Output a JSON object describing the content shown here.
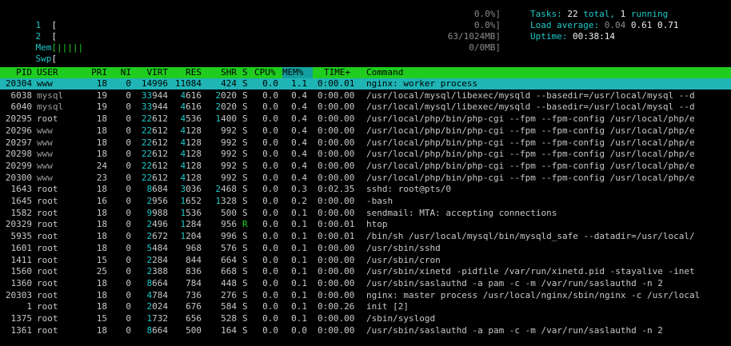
{
  "meters": {
    "cpu1": {
      "label": "1",
      "bar": "[",
      "value": "0.0%]"
    },
    "cpu2": {
      "label": "2",
      "bar": "[",
      "value": "0.0%]"
    },
    "mem": {
      "label": "Mem",
      "bar": "[|||||",
      "value": "63/1024MB]"
    },
    "swp": {
      "label": "Swp",
      "bar": "[",
      "value": "0/0MB]"
    }
  },
  "summary": {
    "tasks_label": "Tasks:",
    "tasks_total": "22",
    "total_label": "total,",
    "running": "1",
    "running_label": "running",
    "load_label": "Load average:",
    "load1": "0.04",
    "load5": "0.61",
    "load15": "0.71",
    "uptime_label": "Uptime:",
    "uptime": "00:38:14"
  },
  "columns": [
    "PID",
    "USER",
    "PRI",
    "NI",
    "VIRT",
    "RES",
    "SHR",
    "S",
    "CPU%",
    "MEM%",
    "TIME+",
    "Command"
  ],
  "processes": [
    {
      "pid": "20304",
      "user": "www",
      "pri": "18",
      "ni": "0",
      "virt": "14996",
      "res": "11084",
      "shr": "424",
      "s": "S",
      "cpu": "0.0",
      "mem": "1.1",
      "time": "0:00.01",
      "cmd": "nginx: worker process"
    },
    {
      "pid": "6038",
      "user": "mysql",
      "pri": "19",
      "ni": "0",
      "virt": "33944",
      "res": "4616",
      "shr": "2020",
      "s": "S",
      "cpu": "0.0",
      "mem": "0.4",
      "time": "0:00.00",
      "cmd": "/usr/local/mysql/libexec/mysqld --basedir=/usr/local/mysql --d"
    },
    {
      "pid": "6040",
      "user": "mysql",
      "pri": "19",
      "ni": "0",
      "virt": "33944",
      "res": "4616",
      "shr": "2020",
      "s": "S",
      "cpu": "0.0",
      "mem": "0.4",
      "time": "0:00.00",
      "cmd": "/usr/local/mysql/libexec/mysqld --basedir=/usr/local/mysql --d"
    },
    {
      "pid": "20295",
      "user": "root",
      "pri": "18",
      "ni": "0",
      "virt": "22612",
      "res": "4536",
      "shr": "1400",
      "s": "S",
      "cpu": "0.0",
      "mem": "0.4",
      "time": "0:00.00",
      "cmd": "/usr/local/php/bin/php-cgi --fpm --fpm-config /usr/local/php/e"
    },
    {
      "pid": "20296",
      "user": "www",
      "pri": "18",
      "ni": "0",
      "virt": "22612",
      "res": "4128",
      "shr": "992",
      "s": "S",
      "cpu": "0.0",
      "mem": "0.4",
      "time": "0:00.00",
      "cmd": "/usr/local/php/bin/php-cgi --fpm --fpm-config /usr/local/php/e"
    },
    {
      "pid": "20297",
      "user": "www",
      "pri": "18",
      "ni": "0",
      "virt": "22612",
      "res": "4128",
      "shr": "992",
      "s": "S",
      "cpu": "0.0",
      "mem": "0.4",
      "time": "0:00.00",
      "cmd": "/usr/local/php/bin/php-cgi --fpm --fpm-config /usr/local/php/e"
    },
    {
      "pid": "20298",
      "user": "www",
      "pri": "18",
      "ni": "0",
      "virt": "22612",
      "res": "4128",
      "shr": "992",
      "s": "S",
      "cpu": "0.0",
      "mem": "0.4",
      "time": "0:00.00",
      "cmd": "/usr/local/php/bin/php-cgi --fpm --fpm-config /usr/local/php/e"
    },
    {
      "pid": "20299",
      "user": "www",
      "pri": "24",
      "ni": "0",
      "virt": "22612",
      "res": "4128",
      "shr": "992",
      "s": "S",
      "cpu": "0.0",
      "mem": "0.4",
      "time": "0:00.00",
      "cmd": "/usr/local/php/bin/php-cgi --fpm --fpm-config /usr/local/php/e"
    },
    {
      "pid": "20300",
      "user": "www",
      "pri": "23",
      "ni": "0",
      "virt": "22612",
      "res": "4128",
      "shr": "992",
      "s": "S",
      "cpu": "0.0",
      "mem": "0.4",
      "time": "0:00.00",
      "cmd": "/usr/local/php/bin/php-cgi --fpm --fpm-config /usr/local/php/e"
    },
    {
      "pid": "1643",
      "user": "root",
      "pri": "18",
      "ni": "0",
      "virt": "8684",
      "res": "3036",
      "shr": "2468",
      "s": "S",
      "cpu": "0.0",
      "mem": "0.3",
      "time": "0:02.35",
      "cmd": "sshd: root@pts/0"
    },
    {
      "pid": "1645",
      "user": "root",
      "pri": "16",
      "ni": "0",
      "virt": "2956",
      "res": "1652",
      "shr": "1328",
      "s": "S",
      "cpu": "0.0",
      "mem": "0.2",
      "time": "0:00.00",
      "cmd": "-bash"
    },
    {
      "pid": "1582",
      "user": "root",
      "pri": "18",
      "ni": "0",
      "virt": "9988",
      "res": "1536",
      "shr": "500",
      "s": "S",
      "cpu": "0.0",
      "mem": "0.1",
      "time": "0:00.00",
      "cmd": "sendmail: MTA: accepting connections"
    },
    {
      "pid": "20329",
      "user": "root",
      "pri": "18",
      "ni": "0",
      "virt": "2496",
      "res": "1284",
      "shr": "956",
      "s": "R",
      "cpu": "0.0",
      "mem": "0.1",
      "time": "0:00.01",
      "cmd": "htop"
    },
    {
      "pid": "5935",
      "user": "root",
      "pri": "18",
      "ni": "0",
      "virt": "2672",
      "res": "1204",
      "shr": "996",
      "s": "S",
      "cpu": "0.0",
      "mem": "0.1",
      "time": "0:00.01",
      "cmd": "/bin/sh /usr/local/mysql/bin/mysqld_safe --datadir=/usr/local/"
    },
    {
      "pid": "1601",
      "user": "root",
      "pri": "18",
      "ni": "0",
      "virt": "5484",
      "res": "968",
      "shr": "576",
      "s": "S",
      "cpu": "0.0",
      "mem": "0.1",
      "time": "0:00.00",
      "cmd": "/usr/sbin/sshd"
    },
    {
      "pid": "1411",
      "user": "root",
      "pri": "15",
      "ni": "0",
      "virt": "2284",
      "res": "844",
      "shr": "664",
      "s": "S",
      "cpu": "0.0",
      "mem": "0.1",
      "time": "0:00.00",
      "cmd": "/usr/sbin/cron"
    },
    {
      "pid": "1560",
      "user": "root",
      "pri": "25",
      "ni": "0",
      "virt": "2388",
      "res": "836",
      "shr": "668",
      "s": "S",
      "cpu": "0.0",
      "mem": "0.1",
      "time": "0:00.00",
      "cmd": "/usr/sbin/xinetd -pidfile /var/run/xinetd.pid -stayalive -inet"
    },
    {
      "pid": "1360",
      "user": "root",
      "pri": "18",
      "ni": "0",
      "virt": "8664",
      "res": "784",
      "shr": "448",
      "s": "S",
      "cpu": "0.0",
      "mem": "0.1",
      "time": "0:00.00",
      "cmd": "/usr/sbin/saslauthd -a pam -c -m /var/run/saslauthd -n 2"
    },
    {
      "pid": "20303",
      "user": "root",
      "pri": "18",
      "ni": "0",
      "virt": "4784",
      "res": "736",
      "shr": "276",
      "s": "S",
      "cpu": "0.0",
      "mem": "0.1",
      "time": "0:00.00",
      "cmd": "nginx: master process /usr/local/nginx/sbin/nginx -c /usr/local"
    },
    {
      "pid": "1",
      "user": "root",
      "pri": "18",
      "ni": "0",
      "virt": "2024",
      "res": "676",
      "shr": "584",
      "s": "S",
      "cpu": "0.0",
      "mem": "0.1",
      "time": "0:00.26",
      "cmd": "init [2]"
    },
    {
      "pid": "1375",
      "user": "root",
      "pri": "15",
      "ni": "0",
      "virt": "1732",
      "res": "656",
      "shr": "528",
      "s": "S",
      "cpu": "0.0",
      "mem": "0.1",
      "time": "0:00.00",
      "cmd": "/sbin/syslogd"
    },
    {
      "pid": "1361",
      "user": "root",
      "pri": "18",
      "ni": "0",
      "virt": "8664",
      "res": "500",
      "shr": "164",
      "s": "S",
      "cpu": "0.0",
      "mem": "0.0",
      "time": "0:00.00",
      "cmd": "/usr/sbin/saslauthd -a pam -c -m /var/run/saslauthd -n 2"
    }
  ],
  "colors": {
    "accent": "#1fc9c9",
    "header_bg": "#1fcc1f",
    "selected_bg": "#1fb5b5"
  }
}
